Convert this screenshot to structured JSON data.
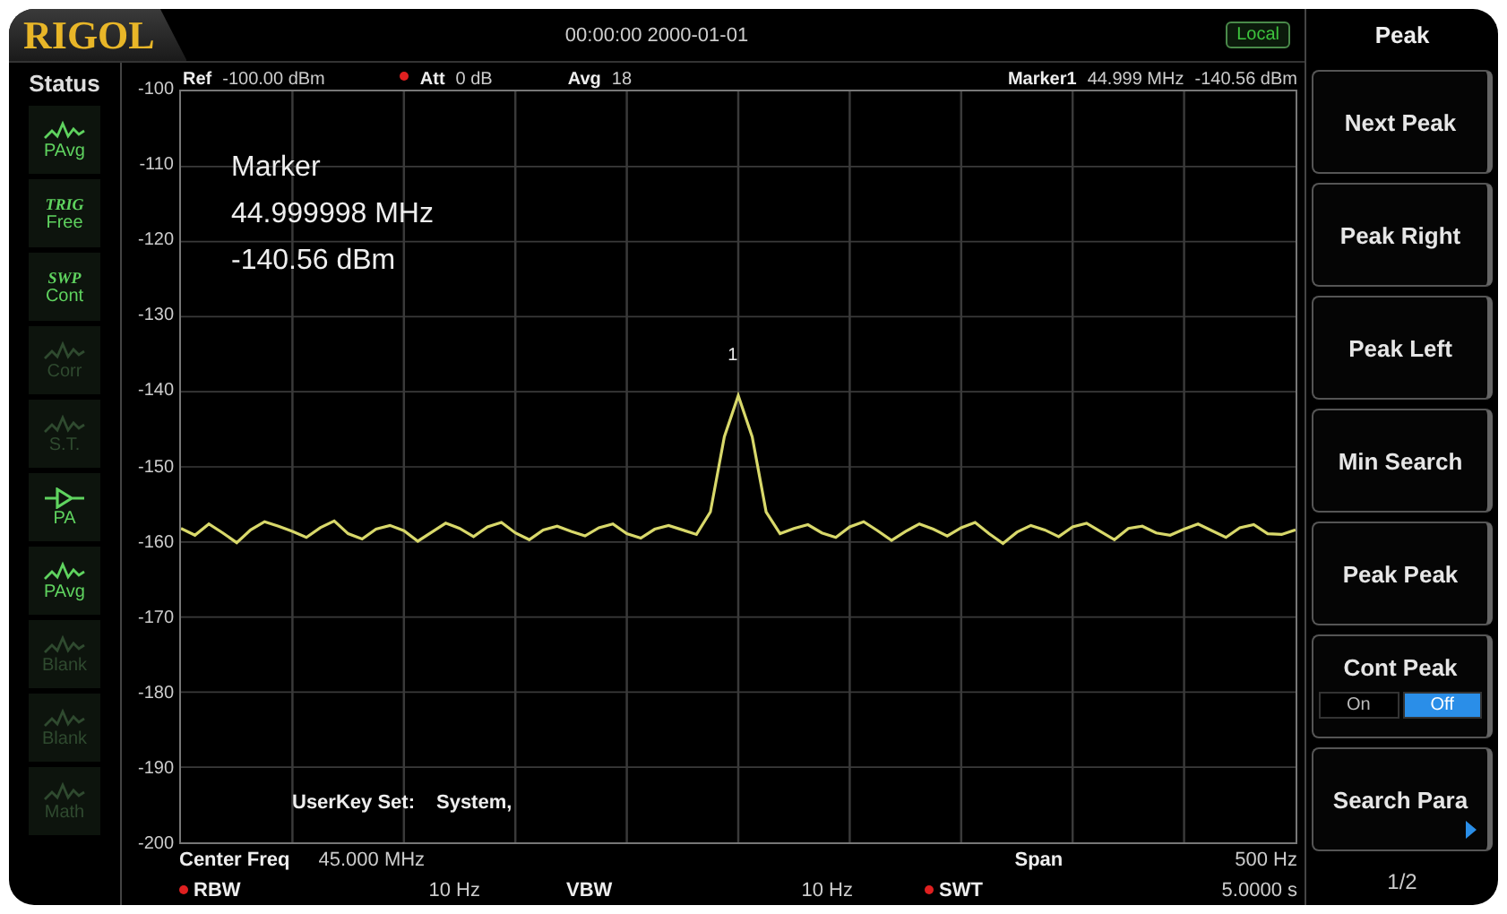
{
  "header": {
    "logo": "RIGOL",
    "datetime": "00:00:00 2000-01-01",
    "mode_badge": "Local"
  },
  "status": {
    "title": "Status",
    "items": [
      {
        "kind": "wave",
        "label": "PAvg",
        "on": true
      },
      {
        "kind": "text",
        "top": "TRIG",
        "label": "Free",
        "on": true
      },
      {
        "kind": "text",
        "top": "SWP",
        "label": "Cont",
        "on": true
      },
      {
        "kind": "wave",
        "label": "Corr",
        "on": false
      },
      {
        "kind": "wave",
        "label": "S.T.",
        "on": false
      },
      {
        "kind": "amplifier",
        "label": "PA",
        "on": true
      },
      {
        "kind": "wave",
        "label": "PAvg",
        "on": true
      },
      {
        "kind": "wave",
        "label": "Blank",
        "on": false
      },
      {
        "kind": "wave",
        "label": "Blank",
        "on": false
      },
      {
        "kind": "wave",
        "label": "Math",
        "on": false
      }
    ]
  },
  "info_bar": {
    "ref": {
      "label": "Ref",
      "value": "-100.00 dBm"
    },
    "att": {
      "label": "Att",
      "value": "0 dB",
      "flagged": true
    },
    "avg": {
      "label": "Avg",
      "value": "18"
    },
    "marker": {
      "label": "Marker1",
      "freq": "44.999 MHz",
      "level": "-140.56 dBm"
    }
  },
  "chart_data": {
    "type": "line",
    "grid": true,
    "ylim": [
      -200,
      -100
    ],
    "yticks": [
      {
        "value": -100,
        "label": "-100"
      },
      {
        "value": -110,
        "label": "-110"
      },
      {
        "value": -120,
        "label": "-120"
      },
      {
        "value": -130,
        "label": "-130"
      },
      {
        "value": -140,
        "label": "-140"
      },
      {
        "value": -150,
        "label": "-150"
      },
      {
        "value": -160,
        "label": "-160"
      },
      {
        "value": -170,
        "label": "-170"
      },
      {
        "value": -180,
        "label": "-180"
      },
      {
        "value": -190,
        "label": "-190"
      },
      {
        "value": -200,
        "label": "-200"
      }
    ],
    "series": [
      {
        "color": "#d8d86a",
        "values": [
          -158.2,
          -159.1,
          -157.6,
          -158.8,
          -160.1,
          -158.4,
          -157.3,
          -157.9,
          -158.6,
          -159.4,
          -158.1,
          -157.2,
          -158.9,
          -159.6,
          -158.3,
          -157.8,
          -158.5,
          -159.9,
          -158.7,
          -157.5,
          -158.2,
          -159.3,
          -158.0,
          -157.4,
          -158.8,
          -159.7,
          -158.4,
          -157.9,
          -158.6,
          -159.2,
          -158.1,
          -157.6,
          -158.9,
          -159.5,
          -158.3,
          -157.8,
          -158.4,
          -159.0,
          -156.0,
          -146.0,
          -140.5,
          -146.0,
          -156.0,
          -158.9,
          -158.2,
          -157.7,
          -158.8,
          -159.4,
          -158.0,
          -157.3,
          -158.5,
          -159.8,
          -158.6,
          -157.6,
          -158.3,
          -159.2,
          -158.1,
          -157.4,
          -158.9,
          -160.2,
          -158.7,
          -157.8,
          -158.4,
          -159.3,
          -158.0,
          -157.5,
          -158.6,
          -159.7,
          -158.2,
          -157.9,
          -158.8,
          -159.1,
          -158.3,
          -157.6,
          -158.5,
          -159.4,
          -158.1,
          -157.7,
          -158.9,
          -159.0,
          -158.4
        ]
      }
    ]
  },
  "marker_readout": [
    "Marker",
    "44.999998 MHz",
    "-140.56 dBm"
  ],
  "peak_marker": "1",
  "userkey": {
    "label": "UserKey Set:",
    "value": "System,"
  },
  "bottom": {
    "center_freq": {
      "label": "Center Freq",
      "value": "45.000 MHz"
    },
    "span": {
      "label": "Span",
      "value": "500 Hz"
    },
    "rbw": {
      "label": "RBW",
      "value": "10 Hz",
      "flagged": true
    },
    "vbw": {
      "label": "VBW",
      "value": "10 Hz",
      "flagged": false
    },
    "swt": {
      "label": "SWT",
      "value": "5.0000 s",
      "flagged": true
    }
  },
  "menu": {
    "title": "Peak",
    "items": [
      {
        "kind": "button",
        "label": "Next Peak"
      },
      {
        "kind": "button",
        "label": "Peak Right"
      },
      {
        "kind": "button",
        "label": "Peak Left"
      },
      {
        "kind": "button",
        "label": "Min Search"
      },
      {
        "kind": "button",
        "label": "Peak Peak"
      },
      {
        "kind": "toggle",
        "label": "Cont Peak",
        "options": [
          {
            "label": "On",
            "selected": false
          },
          {
            "label": "Off",
            "selected": true
          }
        ]
      },
      {
        "kind": "submenu",
        "label": "Search Para"
      }
    ],
    "page": "1/2"
  }
}
